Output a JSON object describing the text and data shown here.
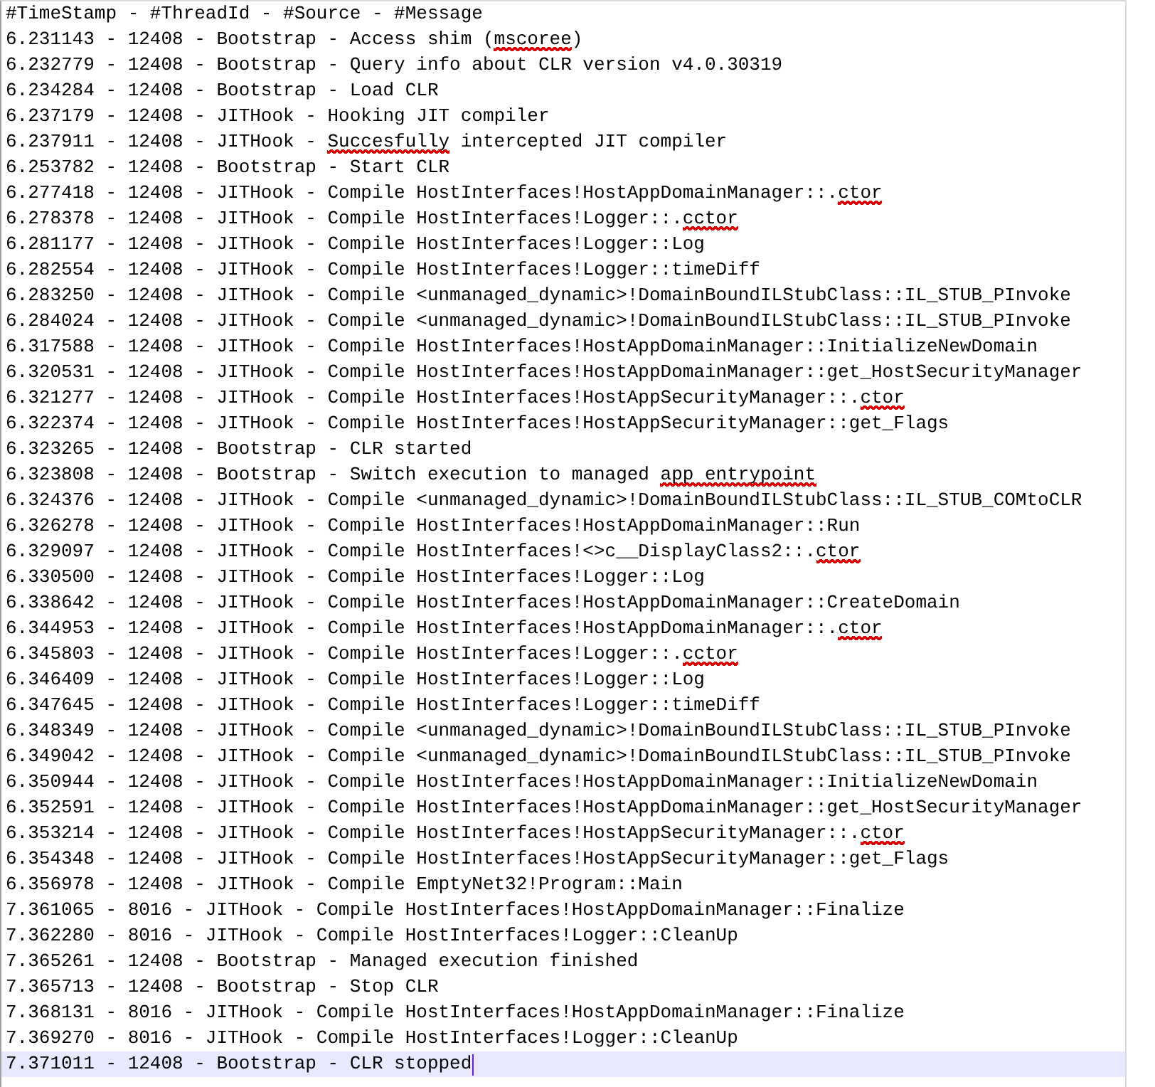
{
  "editor": {
    "lines": [
      {
        "text": "#TimeStamp - #ThreadId - #Source - #Message",
        "current": false
      },
      {
        "parts": [
          {
            "text": "6.231143 - 12408 - Bootstrap - Access shim (",
            "misspelled": false
          },
          {
            "text": "mscoree",
            "misspelled": true
          },
          {
            "text": ")",
            "misspelled": false
          }
        ],
        "current": false
      },
      {
        "text": "6.232779 - 12408 - Bootstrap - Query info about CLR version v4.0.30319",
        "current": false
      },
      {
        "text": "6.234284 - 12408 - Bootstrap - Load CLR",
        "current": false
      },
      {
        "text": "6.237179 - 12408 - JITHook - Hooking JIT compiler",
        "current": false
      },
      {
        "parts": [
          {
            "text": "6.237911 - 12408 - JITHook - ",
            "misspelled": false
          },
          {
            "text": "Succesfully",
            "misspelled": true
          },
          {
            "text": " intercepted JIT compiler",
            "misspelled": false
          }
        ],
        "current": false
      },
      {
        "text": "6.253782 - 12408 - Bootstrap - Start CLR",
        "current": false
      },
      {
        "parts": [
          {
            "text": "6.277418 - 12408 - JITHook - Compile HostInterfaces!HostAppDomainManager::.",
            "misspelled": false
          },
          {
            "text": "ctor",
            "misspelled": true
          }
        ],
        "current": false
      },
      {
        "parts": [
          {
            "text": "6.278378 - 12408 - JITHook - Compile HostInterfaces!Logger::.",
            "misspelled": false
          },
          {
            "text": "cctor",
            "misspelled": true
          }
        ],
        "current": false
      },
      {
        "text": "6.281177 - 12408 - JITHook - Compile HostInterfaces!Logger::Log",
        "current": false
      },
      {
        "text": "6.282554 - 12408 - JITHook - Compile HostInterfaces!Logger::timeDiff",
        "current": false
      },
      {
        "text": "6.283250 - 12408 - JITHook - Compile <unmanaged_dynamic>!DomainBoundILStubClass::IL_STUB_PInvoke",
        "current": false
      },
      {
        "text": "6.284024 - 12408 - JITHook - Compile <unmanaged_dynamic>!DomainBoundILStubClass::IL_STUB_PInvoke",
        "current": false
      },
      {
        "text": "6.317588 - 12408 - JITHook - Compile HostInterfaces!HostAppDomainManager::InitializeNewDomain",
        "current": false
      },
      {
        "text": "6.320531 - 12408 - JITHook - Compile HostInterfaces!HostAppDomainManager::get_HostSecurityManager",
        "current": false
      },
      {
        "parts": [
          {
            "text": "6.321277 - 12408 - JITHook - Compile HostInterfaces!HostAppSecurityManager::.",
            "misspelled": false
          },
          {
            "text": "ctor",
            "misspelled": true
          }
        ],
        "current": false
      },
      {
        "text": "6.322374 - 12408 - JITHook - Compile HostInterfaces!HostAppSecurityManager::get_Flags",
        "current": false
      },
      {
        "text": "6.323265 - 12408 - Bootstrap - CLR started",
        "current": false
      },
      {
        "parts": [
          {
            "text": "6.323808 - 12408 - Bootstrap - Switch execution to managed ",
            "misspelled": false
          },
          {
            "text": "app entrypoint",
            "misspelled": true
          }
        ],
        "current": false
      },
      {
        "text": "6.324376 - 12408 - JITHook - Compile <unmanaged_dynamic>!DomainBoundILStubClass::IL_STUB_COMtoCLR",
        "current": false
      },
      {
        "text": "6.326278 - 12408 - JITHook - Compile HostInterfaces!HostAppDomainManager::Run",
        "current": false
      },
      {
        "parts": [
          {
            "text": "6.329097 - 12408 - JITHook - Compile HostInterfaces!<>c__DisplayClass2::.",
            "misspelled": false
          },
          {
            "text": "ctor",
            "misspelled": true
          }
        ],
        "current": false
      },
      {
        "text": "6.330500 - 12408 - JITHook - Compile HostInterfaces!Logger::Log",
        "current": false
      },
      {
        "text": "6.338642 - 12408 - JITHook - Compile HostInterfaces!HostAppDomainManager::CreateDomain",
        "current": false
      },
      {
        "parts": [
          {
            "text": "6.344953 - 12408 - JITHook - Compile HostInterfaces!HostAppDomainManager::.",
            "misspelled": false
          },
          {
            "text": "ctor",
            "misspelled": true
          }
        ],
        "current": false
      },
      {
        "parts": [
          {
            "text": "6.345803 - 12408 - JITHook - Compile HostInterfaces!Logger::.",
            "misspelled": false
          },
          {
            "text": "cctor",
            "misspelled": true
          }
        ],
        "current": false
      },
      {
        "text": "6.346409 - 12408 - JITHook - Compile HostInterfaces!Logger::Log",
        "current": false
      },
      {
        "text": "6.347645 - 12408 - JITHook - Compile HostInterfaces!Logger::timeDiff",
        "current": false
      },
      {
        "text": "6.348349 - 12408 - JITHook - Compile <unmanaged_dynamic>!DomainBoundILStubClass::IL_STUB_PInvoke",
        "current": false
      },
      {
        "text": "6.349042 - 12408 - JITHook - Compile <unmanaged_dynamic>!DomainBoundILStubClass::IL_STUB_PInvoke",
        "current": false
      },
      {
        "text": "6.350944 - 12408 - JITHook - Compile HostInterfaces!HostAppDomainManager::InitializeNewDomain",
        "current": false
      },
      {
        "text": "6.352591 - 12408 - JITHook - Compile HostInterfaces!HostAppDomainManager::get_HostSecurityManager",
        "current": false
      },
      {
        "parts": [
          {
            "text": "6.353214 - 12408 - JITHook - Compile HostInterfaces!HostAppSecurityManager::.",
            "misspelled": false
          },
          {
            "text": "ctor",
            "misspelled": true
          }
        ],
        "current": false
      },
      {
        "text": "6.354348 - 12408 - JITHook - Compile HostInterfaces!HostAppSecurityManager::get_Flags",
        "current": false
      },
      {
        "text": "6.356978 - 12408 - JITHook - Compile EmptyNet32!Program::Main",
        "current": false
      },
      {
        "text": "7.361065 - 8016 - JITHook - Compile HostInterfaces!HostAppDomainManager::Finalize",
        "current": false
      },
      {
        "text": "7.362280 - 8016 - JITHook - Compile HostInterfaces!Logger::CleanUp",
        "current": false
      },
      {
        "text": "7.365261 - 12408 - Bootstrap - Managed execution finished",
        "current": false
      },
      {
        "text": "7.365713 - 12408 - Bootstrap - Stop CLR",
        "current": false
      },
      {
        "text": "7.368131 - 8016 - JITHook - Compile HostInterfaces!HostAppDomainManager::Finalize",
        "current": false
      },
      {
        "text": "7.369270 - 8016 - JITHook - Compile HostInterfaces!Logger::CleanUp",
        "current": false
      },
      {
        "text": "7.371011 - 12408 - Bootstrap - CLR stopped",
        "current": true
      }
    ]
  }
}
